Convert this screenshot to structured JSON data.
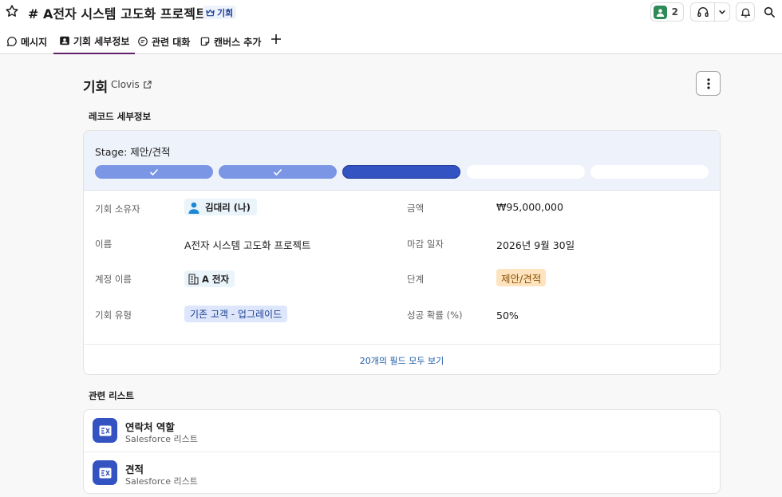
{
  "header": {
    "channel_title": "# A전자 시스템 고도화 프로젝트",
    "badge_label": "기회",
    "member_count": "2"
  },
  "tabs": [
    {
      "label": "메시지"
    },
    {
      "label": "기회 세부정보"
    },
    {
      "label": "관련 대화"
    },
    {
      "label": "캔버스 추가"
    }
  ],
  "record": {
    "title": "기회",
    "source": "Clovis",
    "section_title": "레코드 세부정보",
    "stage_label": "Stage: 제안/견적",
    "stage_progress": {
      "completed": 2,
      "current": 3,
      "total": 5
    },
    "fields": {
      "owner_label": "기회 소유자",
      "owner_value": "김대리 (나)",
      "name_label": "이름",
      "name_value": "A전자 시스템 고도화 프로젝트",
      "account_label": "계정 이름",
      "account_value": "A 전자",
      "type_label": "기회 유형",
      "type_value": "기존 고객 - 업그레이드",
      "amount_label": "금액",
      "amount_value": "₩95,000,000",
      "close_label": "마감 일자",
      "close_value": "2026년 9월 30일",
      "stage_field_label": "단계",
      "stage_field_value": "제안/견적",
      "probability_label": "성공 확률 (%)",
      "probability_value": "50%"
    },
    "view_all_label": "20개의 필드 모두 보기"
  },
  "related": {
    "section_title": "관련 리스트",
    "items": [
      {
        "title": "연락처 역할",
        "subtitle": "Salesforce 리스트"
      },
      {
        "title": "견적",
        "subtitle": "Salesforce 리스트"
      }
    ]
  },
  "colors": {
    "accent": "#611f69",
    "stage_done": "#7b96e5",
    "stage_current": "#3453c2",
    "chip_stage_bg": "#fde4bf",
    "link": "#1c5ba6"
  }
}
